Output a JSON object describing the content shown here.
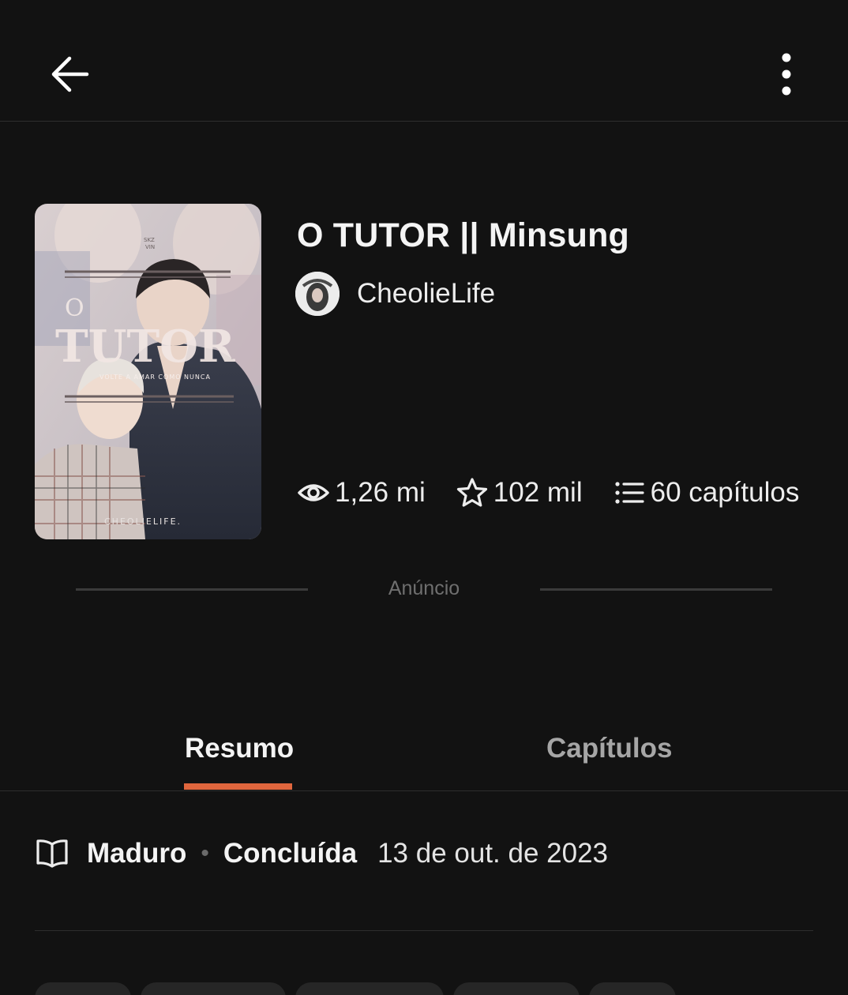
{
  "header": {
    "back_icon": "arrow-left-icon",
    "menu_icon": "more-vertical-icon"
  },
  "story": {
    "title": "O TUTOR || Minsung",
    "author": "CheolieLife",
    "cover": {
      "title_text": "TUTOR",
      "prefix": "O",
      "tagline": "VOLTE A AMAR COMO NUNCA",
      "credit": "CHEOLIELIFE.",
      "badge": "SKZ\nVIN"
    },
    "stats": {
      "views": "1,26 mi",
      "votes": "102 mil",
      "parts": "60 capítulos"
    }
  },
  "ad": {
    "label": "Anúncio"
  },
  "tabs": [
    {
      "label": "Resumo",
      "active": true
    },
    {
      "label": "Capítulos",
      "active": false
    }
  ],
  "meta": {
    "icon": "book-open-icon",
    "rating": "Maduro",
    "separator": "•",
    "status": "Concluída",
    "date": "13 de out. de 2023"
  },
  "colors": {
    "background": "#121212",
    "accent": "#e0663d",
    "divider": "#2e2e2e"
  }
}
